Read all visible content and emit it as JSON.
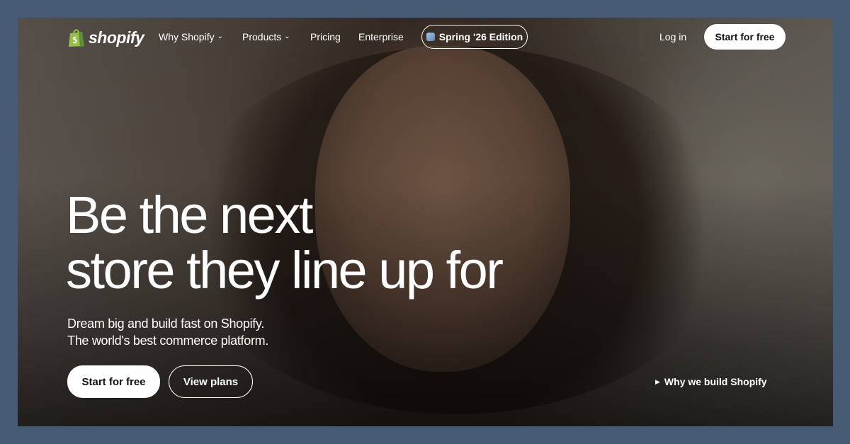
{
  "brand": {
    "name": "shopify",
    "logo_icon": "shopping-bag-icon",
    "logo_color": "#95bf47"
  },
  "nav": {
    "items": [
      {
        "label": "Why Shopify",
        "has_dropdown": true
      },
      {
        "label": "Products",
        "has_dropdown": true
      },
      {
        "label": "Pricing",
        "has_dropdown": false
      },
      {
        "label": "Enterprise",
        "has_dropdown": false
      }
    ],
    "edition_label": "Spring '26 Edition",
    "login_label": "Log in",
    "cta_label": "Start for free"
  },
  "hero": {
    "headline_line1": "Be the next",
    "headline_line2": "store they line up for",
    "subtitle_line1": "Dream big and build fast on Shopify.",
    "subtitle_line2": "The world's best commerce platform.",
    "primary_cta": "Start for free",
    "secondary_cta": "View plans",
    "video_link": "Why we build Shopify"
  },
  "colors": {
    "page_border": "#475a73",
    "button_bg": "#ffffff",
    "text": "#ffffff"
  }
}
